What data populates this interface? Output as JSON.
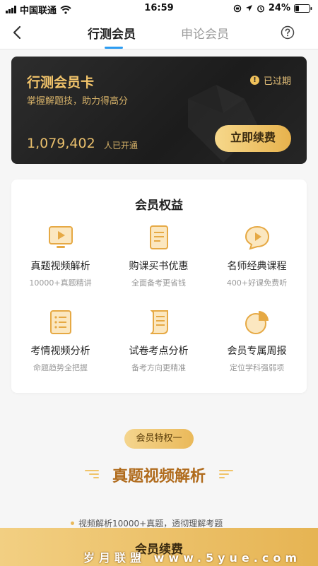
{
  "status_bar": {
    "carrier": "中国联通",
    "time": "16:59",
    "battery": "24%"
  },
  "nav": {
    "tabs": [
      {
        "label": "行测会员"
      },
      {
        "label": "申论会员"
      }
    ]
  },
  "card": {
    "title": "行测会员卡",
    "subtitle": "掌握解题技，助力得高分",
    "expired_label": "已过期",
    "member_count": "1,079,402",
    "member_suffix": "人已开通",
    "renew_button": "立即续费"
  },
  "benefits": {
    "title": "会员权益",
    "items": [
      {
        "name": "真题视频解析",
        "desc": "10000+真题精讲",
        "icon": "video-screen-icon"
      },
      {
        "name": "购课买书优惠",
        "desc": "全面备考更省钱",
        "icon": "book-document-icon"
      },
      {
        "name": "名师经典课程",
        "desc": "400+好课免费听",
        "icon": "play-bubble-icon"
      },
      {
        "name": "考情视频分析",
        "desc": "命题趋势全把握",
        "icon": "list-document-icon"
      },
      {
        "name": "试卷考点分析",
        "desc": "备考方向更精准",
        "icon": "scroll-paper-icon"
      },
      {
        "name": "会员专属周报",
        "desc": "定位学科强弱项",
        "icon": "pie-chart-icon"
      }
    ]
  },
  "privilege": {
    "badge": "会员特权一",
    "title": "真题视频解析",
    "bullet": "视频解析10000+真题，透彻理解考题"
  },
  "bottom": {
    "renew_label": "会员续费",
    "watermark": "岁月联盟 www.5yue.com"
  },
  "colors": {
    "gold": "#eab95a",
    "tab_accent": "#2c9cf2",
    "card_bg": "#222222"
  }
}
